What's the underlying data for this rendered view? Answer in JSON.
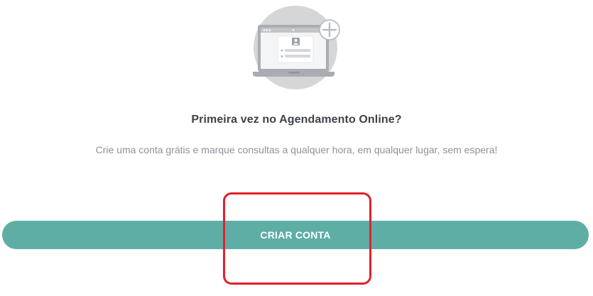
{
  "illustration": {
    "icon": "laptop-account-add-icon",
    "colors": {
      "circle": "#d4d6d8",
      "laptop": "#a9adb1",
      "screen": "#ffffff",
      "plus_badge": "#ffffff"
    }
  },
  "headline": "Primeira vez no Agendamento Online?",
  "subline": "Crie uma conta grátis e marque consultas a qualquer hora, em qualquer lugar, sem espera!",
  "cta": {
    "label": "CRIAR CONTA",
    "color": "#5eaea6"
  },
  "annotation": {
    "type": "highlight-box",
    "color": "#e3202b"
  }
}
